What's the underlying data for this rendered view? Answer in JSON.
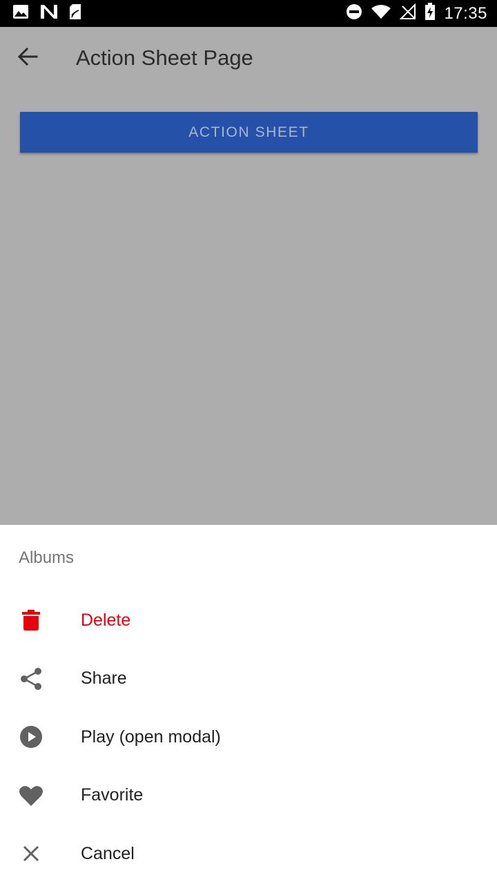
{
  "status_bar": {
    "time": "17:35",
    "left_icons": [
      "image-icon",
      "n-icon",
      "sd-card-icon"
    ],
    "right_icons": [
      "do-not-disturb-icon",
      "wifi-icon",
      "no-signal-icon",
      "battery-charging-icon"
    ]
  },
  "app_bar": {
    "title": "Action Sheet Page",
    "back_icon": "arrow-back-icon"
  },
  "main": {
    "button_label": "ACTION SHEET",
    "button_color": "#2552a8"
  },
  "sheet": {
    "title": "Albums",
    "items": [
      {
        "label": "Delete",
        "icon": "trash-icon",
        "destructive": true
      },
      {
        "label": "Share",
        "icon": "share-icon",
        "destructive": false
      },
      {
        "label": "Play (open modal)",
        "icon": "play-circle-icon",
        "destructive": false
      },
      {
        "label": "Favorite",
        "icon": "heart-icon",
        "destructive": false
      },
      {
        "label": "Cancel",
        "icon": "close-icon",
        "destructive": false
      }
    ]
  },
  "colors": {
    "scrim_background": "#adadad",
    "destructive": "#e8000b",
    "icon": "#616161"
  }
}
